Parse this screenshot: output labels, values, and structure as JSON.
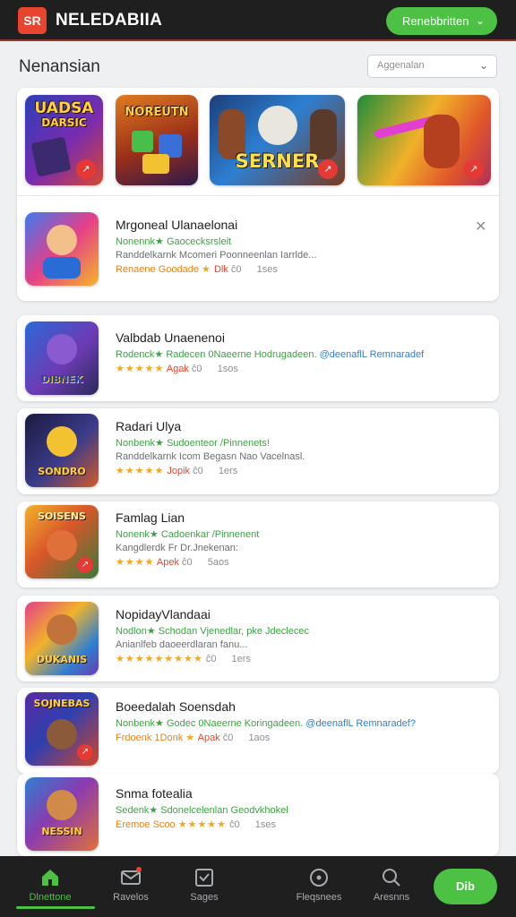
{
  "header": {
    "logo_text": "SR",
    "app_name": "NELEDABIIA",
    "cta_label": "Renebbritten",
    "accent": "#4cc144",
    "brand": "#e8452f"
  },
  "page": {
    "title": "Nenansian",
    "sort_placeholder": "Aggenalan"
  },
  "featured": [
    {
      "title": "UADSA\nDARSIC",
      "icon": "play-badge"
    },
    {
      "title": "NOREUTN",
      "icon": ""
    },
    {
      "title": "SERNER",
      "icon": "play-badge"
    },
    {
      "title": "",
      "icon": "play-badge"
    }
  ],
  "apps": [
    {
      "name": "Mrgoneal Ulanaelonai",
      "tag": "Nonennk★ Gaocecksrsleit",
      "desc": "Randdelkarnk Mcomeri Poonneenlan Iarrlde...",
      "meta_label": "Renaene Goodade",
      "stars": "★",
      "age": "Dlk",
      "rate": "ĉ0",
      "size": "1ses"
    },
    {
      "name": "Valbdab Unaenenoi",
      "tag": "Rodenck★ Radecen 0Naeerne Hodrugadeen.",
      "tag_blue": "@deenaflL Remnaradef",
      "desc": "",
      "meta_label": "",
      "stars": "★★★★★",
      "age": "Agak",
      "rate": "ĉ0",
      "size": "1sos"
    },
    {
      "name": "Radari Ulya",
      "tag": "Nonbenk★ Sudoenteor /Pinnenets!",
      "desc": "Randdelkarnk Icom Begasn Nao Vacelnasl.",
      "meta_label": "",
      "stars": "★★★★★",
      "age": "Jopik",
      "rate": "ĉ0",
      "size": "1ers"
    },
    {
      "name": "Famlag Lian",
      "tag": "Nonenk★ Cadoenkar /Pinnenent",
      "desc": "Kangdlerdk Fr Dr.Jnekenan:",
      "meta_label": "ĉ0",
      "stars": "★★★★",
      "age": "Apek",
      "rate": "ĉ0",
      "size": "5aos"
    },
    {
      "name": "NopidayVlandaai",
      "tag": "Nodlon★ Schodan Vjenedlar, pke Jdeclecec",
      "desc": "Anianlfeb daoeerdlaran fanu...",
      "meta_label": "",
      "stars": "★★★★★★★★★",
      "age": "",
      "rate": "ĉ0",
      "size": "1ers"
    },
    {
      "name": "Boeedalah Soensdah",
      "tag": "Nonbenk★ Godec 0Naeerne Koringadeen.",
      "tag_blue": "@deenaflL Remnaradef?",
      "desc": "",
      "meta_label": "Frdoenk 1Donk",
      "stars": "★",
      "age": "Apak",
      "rate": "ĉ0",
      "size": "1aos"
    },
    {
      "name": "Snma fotealia",
      "tag": "Sedenk★ Sdonelcelenlan Geodvkhokel",
      "desc": "",
      "meta_label": "Eremoe Scoo",
      "stars": "★★★★★",
      "age": "",
      "rate": "ĉ0",
      "size": "1ses"
    }
  ],
  "bottom_nav": [
    {
      "label": "Dlnettone",
      "icon": "home-icon",
      "active": true
    },
    {
      "label": "Ravelos",
      "icon": "mail-icon",
      "active": false
    },
    {
      "label": "Sages",
      "icon": "inbox-icon",
      "active": false
    },
    {
      "label": "Fleqsnees",
      "icon": "compass-icon",
      "active": false
    },
    {
      "label": "Aresnns",
      "icon": "search-icon",
      "active": false
    }
  ],
  "fab_label": "Dib"
}
